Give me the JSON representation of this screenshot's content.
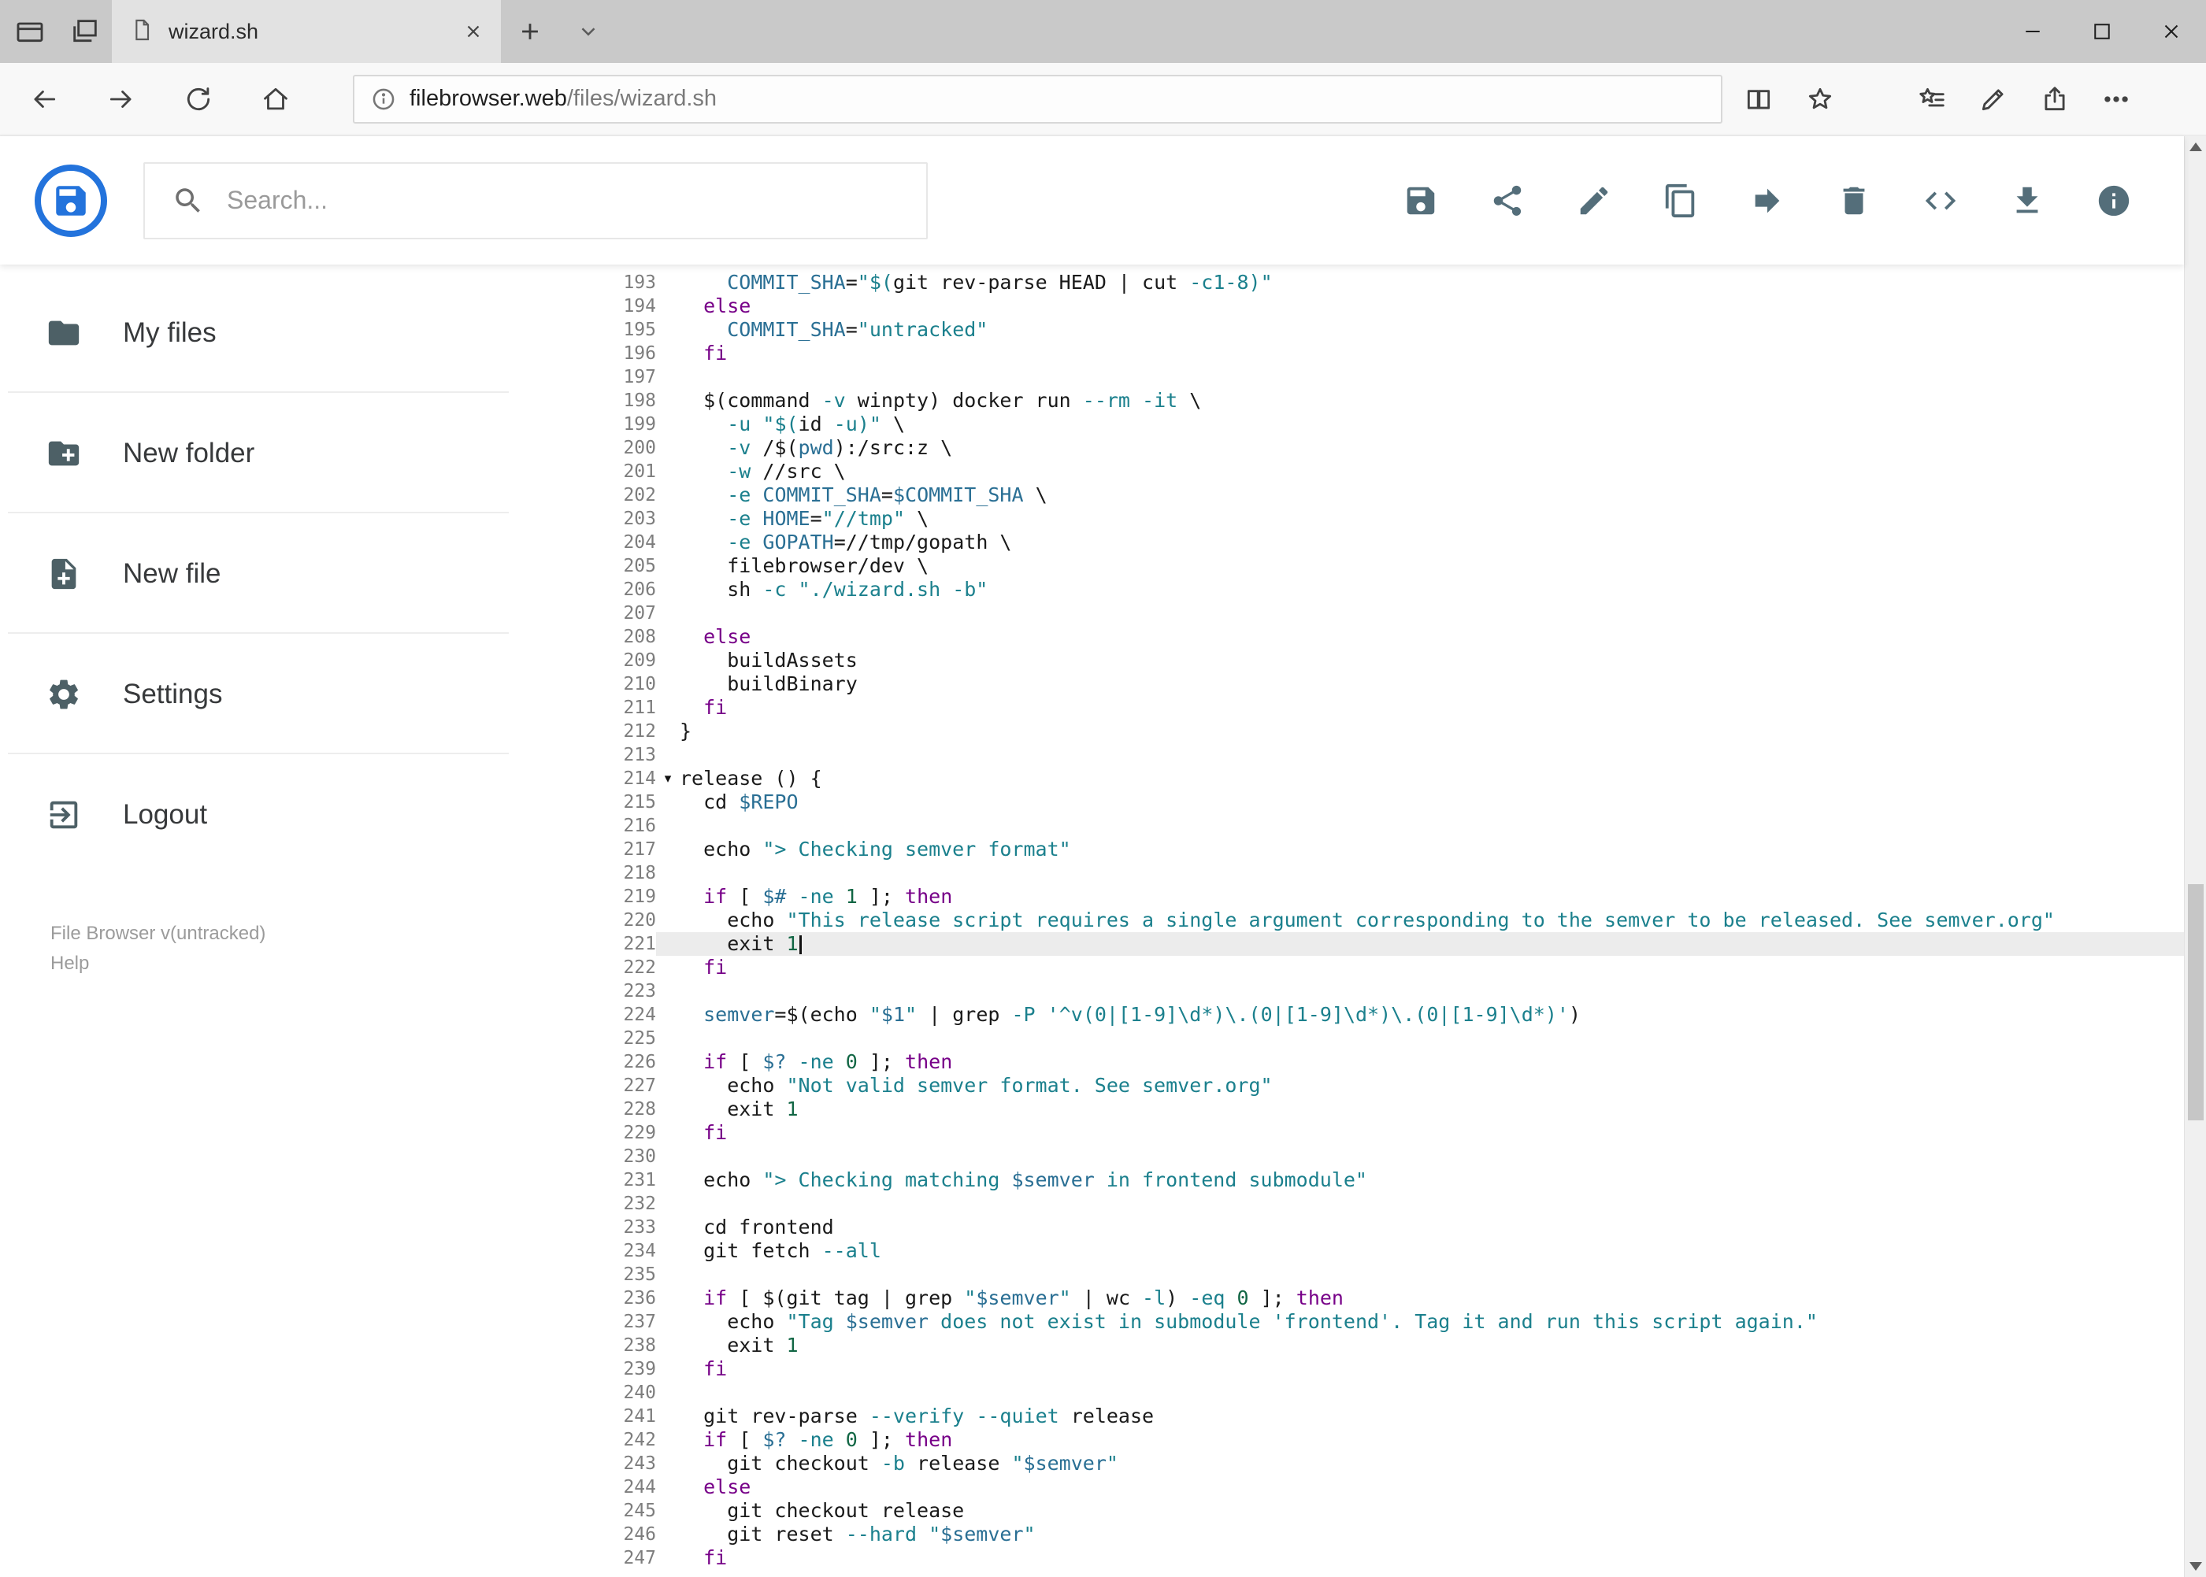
{
  "browser": {
    "tab_title": "wizard.sh",
    "url_host": "filebrowser.web",
    "url_path": "/files/wizard.sh"
  },
  "header": {
    "search_placeholder": "Search..."
  },
  "icons": {
    "browser": [
      "tab-preview",
      "set-tabs-aside",
      "page",
      "close-tab",
      "new-tab",
      "tab-list-chevron",
      "minimize",
      "maximize",
      "close",
      "back",
      "forward",
      "refresh",
      "home",
      "page-info",
      "reading-view",
      "favorite-star",
      "hub",
      "web-note",
      "share",
      "more"
    ],
    "toolbar": [
      "save",
      "share",
      "rename",
      "copy",
      "move",
      "delete",
      "source-code",
      "download",
      "info"
    ],
    "sidebar": [
      "folder",
      "new-folder",
      "new-file",
      "settings",
      "logout"
    ]
  },
  "sidebar": {
    "items": [
      {
        "label": "My files",
        "icon": "folder"
      },
      {
        "label": "New folder",
        "icon": "new-folder"
      },
      {
        "label": "New file",
        "icon": "new-file"
      },
      {
        "label": "Settings",
        "icon": "settings"
      },
      {
        "label": "Logout",
        "icon": "logout"
      }
    ],
    "footer": {
      "version": "File Browser v(untracked)",
      "help": "Help"
    }
  },
  "editor": {
    "first_line": 193,
    "last_line": 247,
    "active_line": 221,
    "fold_marker": "▾",
    "lines": [
      {
        "n": 193,
        "t": [
          [
            "p",
            "    "
          ],
          [
            "d",
            "COMMIT_SHA"
          ],
          [
            "p",
            "="
          ],
          [
            "s",
            "\"$("
          ],
          [
            "p",
            "git rev-parse HEAD | cut "
          ],
          [
            "a",
            "-c1-8"
          ],
          [
            "s",
            ")\""
          ]
        ]
      },
      {
        "n": 194,
        "t": [
          [
            "p",
            "  "
          ],
          [
            "k",
            "else"
          ]
        ]
      },
      {
        "n": 195,
        "t": [
          [
            "p",
            "    "
          ],
          [
            "d",
            "COMMIT_SHA"
          ],
          [
            "p",
            "="
          ],
          [
            "s",
            "\"untracked\""
          ]
        ]
      },
      {
        "n": 196,
        "t": [
          [
            "p",
            "  "
          ],
          [
            "k",
            "fi"
          ]
        ]
      },
      {
        "n": 197,
        "t": []
      },
      {
        "n": 198,
        "t": [
          [
            "p",
            "  $(command "
          ],
          [
            "a",
            "-v"
          ],
          [
            "p",
            " winpty) docker run "
          ],
          [
            "a",
            "--rm"
          ],
          [
            "p",
            " "
          ],
          [
            "a",
            "-it"
          ],
          [
            "p",
            " \\"
          ]
        ]
      },
      {
        "n": 199,
        "t": [
          [
            "p",
            "    "
          ],
          [
            "a",
            "-u"
          ],
          [
            "p",
            " "
          ],
          [
            "s",
            "\"$("
          ],
          [
            "p",
            "id "
          ],
          [
            "a",
            "-u"
          ],
          [
            "s",
            ")\""
          ],
          [
            "p",
            " \\"
          ]
        ]
      },
      {
        "n": 200,
        "t": [
          [
            "p",
            "    "
          ],
          [
            "a",
            "-v"
          ],
          [
            "p",
            " /$("
          ],
          [
            "v",
            "pwd"
          ],
          [
            "p",
            "):/src:z \\"
          ]
        ]
      },
      {
        "n": 201,
        "t": [
          [
            "p",
            "    "
          ],
          [
            "a",
            "-w"
          ],
          [
            "p",
            " //src \\"
          ]
        ]
      },
      {
        "n": 202,
        "t": [
          [
            "p",
            "    "
          ],
          [
            "a",
            "-e"
          ],
          [
            "p",
            " "
          ],
          [
            "d",
            "COMMIT_SHA"
          ],
          [
            "p",
            "="
          ],
          [
            "v",
            "$COMMIT_SHA"
          ],
          [
            "p",
            " \\"
          ]
        ]
      },
      {
        "n": 203,
        "t": [
          [
            "p",
            "    "
          ],
          [
            "a",
            "-e"
          ],
          [
            "p",
            " "
          ],
          [
            "d",
            "HOME"
          ],
          [
            "p",
            "="
          ],
          [
            "s",
            "\"//tmp\""
          ],
          [
            "p",
            " \\"
          ]
        ]
      },
      {
        "n": 204,
        "t": [
          [
            "p",
            "    "
          ],
          [
            "a",
            "-e"
          ],
          [
            "p",
            " "
          ],
          [
            "d",
            "GOPATH"
          ],
          [
            "p",
            "=//tmp/gopath \\"
          ]
        ]
      },
      {
        "n": 205,
        "t": [
          [
            "p",
            "    filebrowser/dev \\"
          ]
        ]
      },
      {
        "n": 206,
        "t": [
          [
            "p",
            "    sh "
          ],
          [
            "a",
            "-c"
          ],
          [
            "p",
            " "
          ],
          [
            "s",
            "\"./wizard.sh -b\""
          ]
        ]
      },
      {
        "n": 207,
        "t": []
      },
      {
        "n": 208,
        "t": [
          [
            "p",
            "  "
          ],
          [
            "k",
            "else"
          ]
        ]
      },
      {
        "n": 209,
        "t": [
          [
            "p",
            "    buildAssets"
          ]
        ]
      },
      {
        "n": 210,
        "t": [
          [
            "p",
            "    buildBinary"
          ]
        ]
      },
      {
        "n": 211,
        "t": [
          [
            "p",
            "  "
          ],
          [
            "k",
            "fi"
          ]
        ]
      },
      {
        "n": 212,
        "t": [
          [
            "p",
            "}"
          ]
        ]
      },
      {
        "n": 213,
        "t": []
      },
      {
        "n": 214,
        "fold": true,
        "t": [
          [
            "p",
            "release () {"
          ]
        ]
      },
      {
        "n": 215,
        "t": [
          [
            "p",
            "  cd "
          ],
          [
            "v",
            "$REPO"
          ]
        ]
      },
      {
        "n": 216,
        "t": []
      },
      {
        "n": 217,
        "t": [
          [
            "p",
            "  echo "
          ],
          [
            "s",
            "\"> Checking semver format\""
          ]
        ]
      },
      {
        "n": 218,
        "t": []
      },
      {
        "n": 219,
        "t": [
          [
            "p",
            "  "
          ],
          [
            "k",
            "if"
          ],
          [
            "p",
            " [ "
          ],
          [
            "v",
            "$#"
          ],
          [
            "p",
            " "
          ],
          [
            "a",
            "-ne"
          ],
          [
            "p",
            " "
          ],
          [
            "n",
            "1"
          ],
          [
            "p",
            " ]; "
          ],
          [
            "k",
            "then"
          ]
        ]
      },
      {
        "n": 220,
        "t": [
          [
            "p",
            "    echo "
          ],
          [
            "s",
            "\"This release script requires a single argument corresponding to the semver to be released. See semver.org\""
          ]
        ]
      },
      {
        "n": 221,
        "active": true,
        "cursor": true,
        "t": [
          [
            "p",
            "    exit "
          ],
          [
            "n",
            "1"
          ]
        ]
      },
      {
        "n": 222,
        "t": [
          [
            "p",
            "  "
          ],
          [
            "k",
            "fi"
          ]
        ]
      },
      {
        "n": 223,
        "t": []
      },
      {
        "n": 224,
        "t": [
          [
            "p",
            "  "
          ],
          [
            "d",
            "semver"
          ],
          [
            "p",
            "=$(echo "
          ],
          [
            "s",
            "\""
          ],
          [
            "v",
            "$1"
          ],
          [
            "s",
            "\""
          ],
          [
            "p",
            " | grep "
          ],
          [
            "a",
            "-P"
          ],
          [
            "p",
            " "
          ],
          [
            "s",
            "'^v(0|[1-9]\\d*)\\.(0|[1-9]\\d*)\\.(0|[1-9]\\d*)'"
          ],
          [
            "p",
            ")"
          ]
        ]
      },
      {
        "n": 225,
        "t": []
      },
      {
        "n": 226,
        "t": [
          [
            "p",
            "  "
          ],
          [
            "k",
            "if"
          ],
          [
            "p",
            " [ "
          ],
          [
            "v",
            "$?"
          ],
          [
            "p",
            " "
          ],
          [
            "a",
            "-ne"
          ],
          [
            "p",
            " "
          ],
          [
            "n",
            "0"
          ],
          [
            "p",
            " ]; "
          ],
          [
            "k",
            "then"
          ]
        ]
      },
      {
        "n": 227,
        "t": [
          [
            "p",
            "    echo "
          ],
          [
            "s",
            "\"Not valid semver format. See semver.org\""
          ]
        ]
      },
      {
        "n": 228,
        "t": [
          [
            "p",
            "    exit "
          ],
          [
            "n",
            "1"
          ]
        ]
      },
      {
        "n": 229,
        "t": [
          [
            "p",
            "  "
          ],
          [
            "k",
            "fi"
          ]
        ]
      },
      {
        "n": 230,
        "t": []
      },
      {
        "n": 231,
        "t": [
          [
            "p",
            "  echo "
          ],
          [
            "s",
            "\"> Checking matching "
          ],
          [
            "v",
            "$semver"
          ],
          [
            "s",
            " in frontend submodule\""
          ]
        ]
      },
      {
        "n": 232,
        "t": []
      },
      {
        "n": 233,
        "t": [
          [
            "p",
            "  cd frontend"
          ]
        ]
      },
      {
        "n": 234,
        "t": [
          [
            "p",
            "  git fetch "
          ],
          [
            "a",
            "--all"
          ]
        ]
      },
      {
        "n": 235,
        "t": []
      },
      {
        "n": 236,
        "t": [
          [
            "p",
            "  "
          ],
          [
            "k",
            "if"
          ],
          [
            "p",
            " [ $(git tag | grep "
          ],
          [
            "s",
            "\""
          ],
          [
            "v",
            "$semver"
          ],
          [
            "s",
            "\""
          ],
          [
            "p",
            " | wc "
          ],
          [
            "a",
            "-l"
          ],
          [
            "p",
            ") "
          ],
          [
            "a",
            "-eq"
          ],
          [
            "p",
            " "
          ],
          [
            "n",
            "0"
          ],
          [
            "p",
            " ]; "
          ],
          [
            "k",
            "then"
          ]
        ]
      },
      {
        "n": 237,
        "t": [
          [
            "p",
            "    echo "
          ],
          [
            "s",
            "\"Tag "
          ],
          [
            "v",
            "$semver"
          ],
          [
            "s",
            " does not exist in submodule 'frontend'. Tag it and run this script again.\""
          ]
        ]
      },
      {
        "n": 238,
        "t": [
          [
            "p",
            "    exit "
          ],
          [
            "n",
            "1"
          ]
        ]
      },
      {
        "n": 239,
        "t": [
          [
            "p",
            "  "
          ],
          [
            "k",
            "fi"
          ]
        ]
      },
      {
        "n": 240,
        "t": []
      },
      {
        "n": 241,
        "t": [
          [
            "p",
            "  git rev-parse "
          ],
          [
            "a",
            "--verify"
          ],
          [
            "p",
            " "
          ],
          [
            "a",
            "--quiet"
          ],
          [
            "p",
            " release"
          ]
        ]
      },
      {
        "n": 242,
        "t": [
          [
            "p",
            "  "
          ],
          [
            "k",
            "if"
          ],
          [
            "p",
            " [ "
          ],
          [
            "v",
            "$?"
          ],
          [
            "p",
            " "
          ],
          [
            "a",
            "-ne"
          ],
          [
            "p",
            " "
          ],
          [
            "n",
            "0"
          ],
          [
            "p",
            " ]; "
          ],
          [
            "k",
            "then"
          ]
        ]
      },
      {
        "n": 243,
        "t": [
          [
            "p",
            "    git checkout "
          ],
          [
            "a",
            "-b"
          ],
          [
            "p",
            " release "
          ],
          [
            "s",
            "\""
          ],
          [
            "v",
            "$semver"
          ],
          [
            "s",
            "\""
          ]
        ]
      },
      {
        "n": 244,
        "t": [
          [
            "p",
            "  "
          ],
          [
            "k",
            "else"
          ]
        ]
      },
      {
        "n": 245,
        "t": [
          [
            "p",
            "    git checkout release"
          ]
        ]
      },
      {
        "n": 246,
        "t": [
          [
            "p",
            "    git reset "
          ],
          [
            "a",
            "--hard"
          ],
          [
            "p",
            " "
          ],
          [
            "s",
            "\""
          ],
          [
            "v",
            "$semver"
          ],
          [
            "s",
            "\""
          ]
        ]
      },
      {
        "n": 247,
        "t": [
          [
            "p",
            "  "
          ],
          [
            "k",
            "fi"
          ]
        ]
      }
    ]
  }
}
